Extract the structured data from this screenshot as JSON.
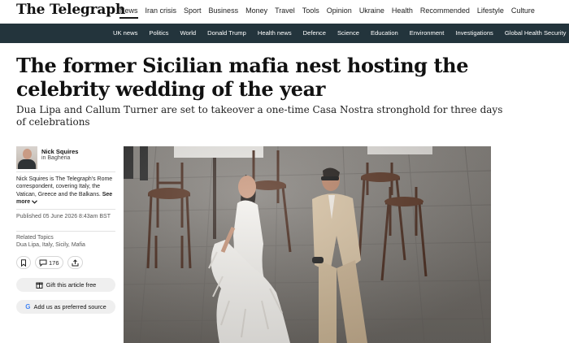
{
  "site": {
    "logo_text": "The Telegraph"
  },
  "top_nav": {
    "items": [
      "News",
      "Iran crisis",
      "Sport",
      "Business",
      "Money",
      "Travel",
      "Tools",
      "Opinion",
      "Ukraine",
      "Health",
      "Recommended",
      "Lifestyle",
      "Culture"
    ],
    "active": "News"
  },
  "sub_nav": {
    "items": [
      "UK news",
      "Politics",
      "World",
      "Donald Trump",
      "Health news",
      "Defence",
      "Science",
      "Education",
      "Environment",
      "Investigations",
      "Global Health Security"
    ]
  },
  "article": {
    "headline": "The former Sicilian mafia nest hosting the celebrity wedding of the year",
    "standfirst": "Dua Lipa and Callum Turner are set to takeover a one-time Casa Nostra stronghold for three days of celebrations"
  },
  "author": {
    "name": "Nick Squires",
    "location": "in Bagheria",
    "bio": "Nick Squires is The Telegraph's Rome correspondent, covering Italy, the Vatican, Greece and the Balkans.",
    "see_more": "See more"
  },
  "meta": {
    "published": "Published 05 June 2026 8:43am BST",
    "topics_label": "Related Topics",
    "topics": "Dua Lipa, Italy, Sicily, Mafia"
  },
  "actions": {
    "comment_count": "176",
    "gift_label": "Gift this article free",
    "google_label": "Add us as preferred source"
  },
  "colors": {
    "subnav_bg": "#23343c",
    "pill_bg": "#efefef"
  }
}
